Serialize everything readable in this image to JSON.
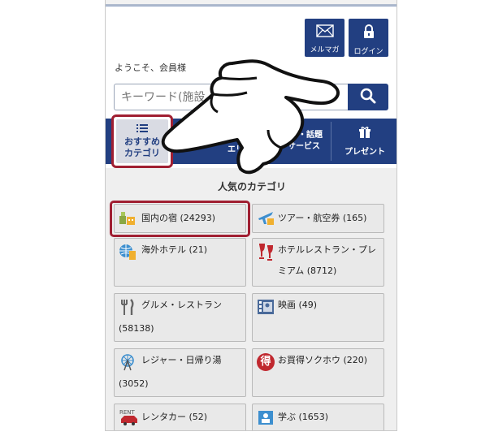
{
  "header": {
    "newsletter_label": "メルマガ",
    "login_label": "ログイン",
    "welcome": "ようこそ、会員様"
  },
  "search": {
    "placeholder": "キーワード(施設",
    "clear_glyph": "×"
  },
  "nav": {
    "items": [
      {
        "label_line1": "おすすめ",
        "label_line2": "カテゴリ"
      },
      {
        "label_line1": "",
        "label_line2": "エリ"
      },
      {
        "label_line1": "・話題",
        "label_line2": "サービス"
      },
      {
        "label_line1": "プレゼント",
        "label_line2": ""
      }
    ]
  },
  "section_title": "人気のカテゴリ",
  "categories": [
    {
      "label": "国内の宿 (24293)",
      "icon": "domestic-inn-icon"
    },
    {
      "label": "ツアー・航空券 (165)",
      "icon": "airplane-icon"
    },
    {
      "label": "海外ホテル (21)",
      "icon": "globe-hotel-icon"
    },
    {
      "label": "ホテルレストラン・プレミアム (8712)",
      "icon": "wine-glass-icon"
    },
    {
      "label": "グルメ・レストラン",
      "label2": "(58138)",
      "icon": "fork-knife-icon"
    },
    {
      "label": "映画 (49)",
      "icon": "film-icon"
    },
    {
      "label": "レジャー・日帰り湯",
      "label2": "(3052)",
      "icon": "ferris-wheel-icon"
    },
    {
      "label": "お買得ソクホウ (220)",
      "icon": "bargain-icon",
      "badge": "得"
    },
    {
      "label": "レンタカー (52)",
      "icon": "rental-car-icon",
      "badge": "RENT"
    },
    {
      "label": "学ぶ (1653)",
      "icon": "study-icon"
    }
  ],
  "colors": {
    "brand": "#223f81",
    "highlight": "#a01f32",
    "panel": "#efefef"
  }
}
